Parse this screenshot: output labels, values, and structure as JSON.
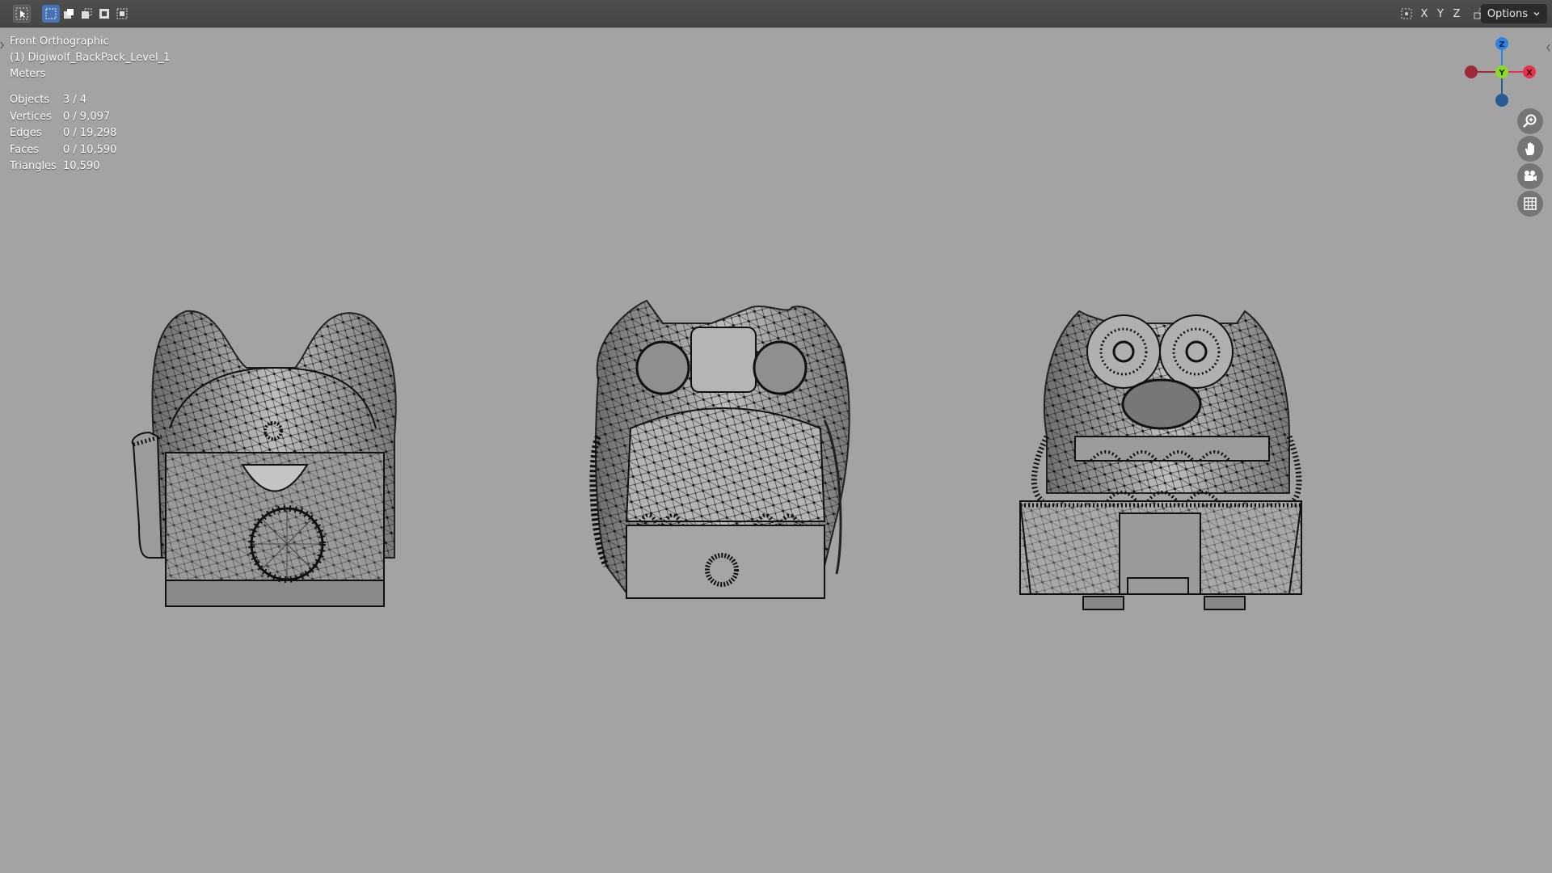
{
  "header": {
    "options_label": "Options",
    "axis_x": "X",
    "axis_y": "Y",
    "axis_z": "Z",
    "tools": [
      "select-tool-icon",
      "mode-new-icon",
      "mode-extend-icon",
      "mode-subtract-icon",
      "mode-invert-icon",
      "mode-intersect-icon"
    ]
  },
  "viewport": {
    "view_name": "Front Orthographic",
    "object_name": "(1) Digiwolf_BackPack_Level_1",
    "units": "Meters"
  },
  "stats": [
    {
      "label": "Objects",
      "value": "3 / 4"
    },
    {
      "label": "Vertices",
      "value": "0 / 9,097"
    },
    {
      "label": "Edges",
      "value": "0 / 19,298"
    },
    {
      "label": "Faces",
      "value": "0 / 10,590"
    },
    {
      "label": "Triangles",
      "value": "10,590"
    }
  ],
  "gizmo": {
    "z_label": "Z",
    "y_label": "Y",
    "x_label": "X",
    "colors": {
      "x": "#e8324b",
      "y": "#8bdc28",
      "z": "#2f83e2",
      "neg_x": "#9c2b3a",
      "neg_z": "#2a5a92"
    }
  },
  "nav_tools": [
    "zoom-icon",
    "pan-hand-icon",
    "camera-icon",
    "grid-icon"
  ],
  "colors": {
    "viewport_bg": "#a3a3a3",
    "header_bg": "#4a4a4a",
    "selected_mode": "#4772b3"
  }
}
